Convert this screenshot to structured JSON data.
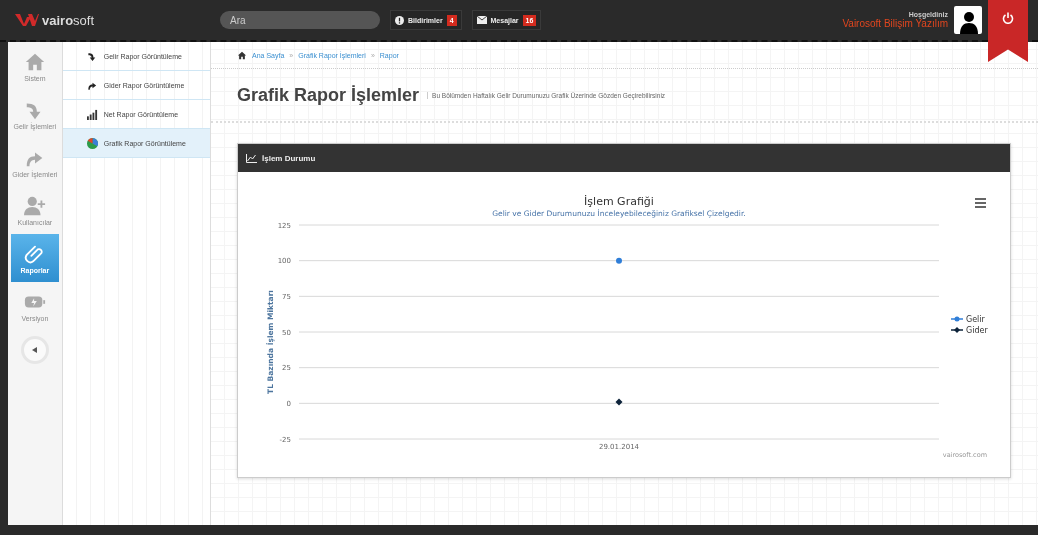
{
  "header": {
    "logo": "**vairo**soft",
    "search": {
      "placeholder": "Ara"
    },
    "buttons": [
      {
        "kind": "alert",
        "label": "Bildirimler",
        "count": "4"
      },
      {
        "kind": "mail",
        "label": "Mesajlar",
        "count": "16"
      }
    ],
    "welcome": "Hoşgeldiniz",
    "user": "Vairosoft Bilişim Yazılım"
  },
  "sidebar": {
    "items": [
      {
        "kind": "home",
        "label": "Sistem",
        "selected": false
      },
      {
        "kind": "down",
        "label": "Gelir İşlemleri",
        "selected": false
      },
      {
        "kind": "up",
        "label": "Gider İşlemleri",
        "selected": false
      },
      {
        "kind": "user",
        "label": "Kullanıcılar",
        "selected": false
      },
      {
        "kind": "clip",
        "label": "Raporlar",
        "selected": true
      },
      {
        "kind": "battery",
        "label": "Versiyon",
        "selected": false
      }
    ]
  },
  "submenu": {
    "items": [
      {
        "kind": "down",
        "label": "Gelir Rapor Görüntüleme",
        "selected": false
      },
      {
        "kind": "up",
        "label": "Gider Rapor Görüntüleme",
        "selected": false
      },
      {
        "kind": "bars",
        "label": "Net Rapor Görüntüleme",
        "selected": false
      },
      {
        "kind": "pie",
        "label": "Grafik Rapor Görüntüleme",
        "selected": true
      }
    ]
  },
  "breadcrumb": {
    "separator": "»",
    "items": [
      "Ana Sayfa",
      "Grafik Rapor İşlemleri",
      "Rapor"
    ]
  },
  "page": {
    "title": "Grafik Rapor İşlemler",
    "subtitle": "Bu Bölümden Haftalık Gelir Durumunuzu Grafik Üzerinde Gözden Geçirebilirsiniz"
  },
  "panel": {
    "title": "İşlem Durumu",
    "chart_data": {
      "type": "scatter",
      "title": "İşlem Grafiği",
      "subtitle": "Gelir ve Gider Durumunuzu İnceleyebileceğiniz Grafiksel Çizelgedir.",
      "ylabel": "TL Bazında İşlem Miktarı",
      "categories": [
        "29.01.2014"
      ],
      "ylim": [
        -25,
        125
      ],
      "yticks": [
        -25,
        0,
        25,
        50,
        75,
        100,
        125
      ],
      "series": [
        {
          "name": "Gelir",
          "color": "#2f7ed8",
          "values": [
            100
          ]
        },
        {
          "name": "Gider",
          "color": "#0d233a",
          "values": [
            1
          ]
        }
      ],
      "grid": true,
      "legend": true,
      "annotations": [
        {
          "text": "vairosoft.com"
        }
      ]
    }
  }
}
